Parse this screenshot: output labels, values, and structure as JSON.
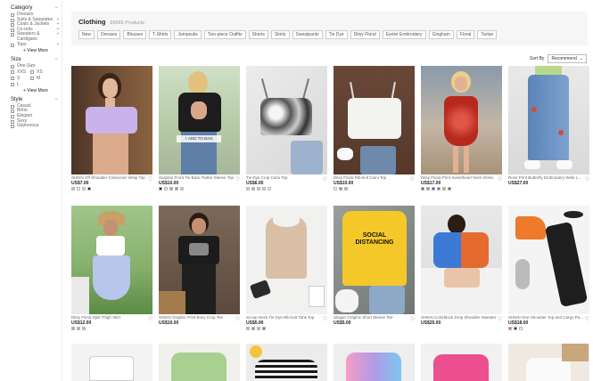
{
  "sidebar": {
    "category": {
      "title": "Category",
      "toggle": "−",
      "items": [
        {
          "label": "Dresses",
          "mark": ""
        },
        {
          "label": "Suits & Separates",
          "mark": "+"
        },
        {
          "label": "Coats & Jackets",
          "mark": "+"
        },
        {
          "label": "Co-ords",
          "mark": "+"
        },
        {
          "label": "Sweaters & Cardigans",
          "mark": "+"
        },
        {
          "label": "Tops",
          "mark": "+"
        }
      ],
      "view_more": "+ View More"
    },
    "size": {
      "title": "Size",
      "toggle": "−",
      "single": "One-Size",
      "grid": [
        "XXS",
        "XS",
        "S",
        "M",
        "L"
      ],
      "view_more": "+ View More"
    },
    "style": {
      "title": "Style",
      "toggle": "−",
      "items": [
        "Casual",
        "Boho",
        "Elegant",
        "Sexy",
        "Glamorous"
      ]
    }
  },
  "header": {
    "title": "Clothing",
    "count": "65665 Products",
    "chips": [
      "New",
      "Dresses",
      "Blouses",
      "T-Shirts",
      "Jumpsuits",
      "Two-piece Outfits",
      "Shorts",
      "Skirts",
      "Sweatpants",
      "Tie Dye",
      "Ditsy Floral",
      "Eyelet Embroidery",
      "Gingham",
      "Floral",
      "Tartan"
    ]
  },
  "sort": {
    "label": "Sort By",
    "value": "Recommend",
    "caret": "⌄"
  },
  "add_to_bag": "+ ADD TO BAG",
  "fav_glyph": "♡",
  "products": [
    {
      "name": "SHEIN Off Shoulder Crisscross Wrap Top",
      "price": "US$7.00",
      "swatches": [
        "#c9b7e6",
        "#f2f2f2",
        "#ddd0f0",
        "#222222"
      ],
      "img": "lilac-top"
    },
    {
      "name": "Surplice Front Tie Back Flutter Sleeve Top",
      "price": "US$10.00",
      "swatches": [
        "#111111",
        "#e4e4e4",
        "#b39a8a",
        "#6fa0c8",
        "#d0d0d0"
      ],
      "img": "black-tie"
    },
    {
      "name": "Tie Dye Crop Cami Top",
      "price": "US$6.00",
      "swatches": [
        "#cfcfcf",
        "#d59fd3",
        "#b8c7e8",
        "#a6d9d3",
        "#eeeeee"
      ],
      "img": "tiedye"
    },
    {
      "name": "Ditsy Floral Rib-knit Cami Top",
      "price": "US$10.00",
      "swatches": [
        "#f5f5f5",
        "#8a9a6d",
        "#dd9cb6"
      ],
      "img": "white-cami"
    },
    {
      "name": "Ditsy Floral Print Sweetheart Neck Dress",
      "price": "US$17.00",
      "swatches": [
        "#c0392b",
        "#6d8fd0",
        "#3a5f9e",
        "#b04ec4",
        "#e4a04a",
        "#8a5b3a"
      ],
      "img": "red-dress"
    },
    {
      "name": "Rose Print Butterfly Embroidery Wide Leg Jeans",
      "price": "US$27.00",
      "swatches": [],
      "img": "jeans"
    },
    {
      "name": "Ditsy Floral Split Thigh Skirt",
      "price": "US$12.00",
      "swatches": [
        "#8fa6d9",
        "#e49e9e",
        "#a4c3e8"
      ],
      "img": "skirt"
    },
    {
      "name": "SHEIN Graphic Print Boxy Crop Tee",
      "price": "US$10.00",
      "swatches": [],
      "img": "graphic-tee"
    },
    {
      "name": "Scoop Neck Tie Dye Rib-knit Tank Top",
      "price": "US$5.00",
      "swatches": [
        "#cdb7a8",
        "#9b85c4",
        "#d7a6b0",
        "#7a7a7a"
      ],
      "img": "beige-tank"
    },
    {
      "name": "Slogan Graphic Short Sleeve Tee",
      "price": "US$5.00",
      "swatches": [],
      "img": "social-tee"
    },
    {
      "name": "SHEIN Colorblock Drop Shoulder Sweater",
      "price": "US$25.00",
      "swatches": [],
      "img": "colorblock"
    },
    {
      "name": "SHEIN One Shoulder Top and Cargo Pants",
      "price": "US$18.00",
      "swatches": [
        "#e8772e",
        "#222222",
        "#eeeeee"
      ],
      "img": "orange-set"
    }
  ],
  "social_text": "SOCIAL DISTANCING",
  "row3": [
    "white-shirt",
    "green-tee",
    "stripe-tee",
    "tiedye-hoodie",
    "pink-tee",
    "white-top"
  ]
}
